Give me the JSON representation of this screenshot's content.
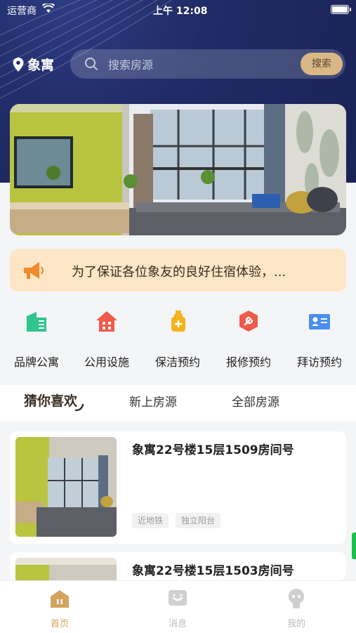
{
  "status": {
    "carrier": "运营商",
    "time": "上午 12:08"
  },
  "location": "象寓",
  "search": {
    "placeholder": "搜索房源",
    "button": "搜索"
  },
  "notice": "为了保证各位象友的良好住宿体验，...",
  "categories": [
    {
      "label": "品牌公寓",
      "icon": "building-icon",
      "color": "#2fc58d"
    },
    {
      "label": "公用设施",
      "icon": "house-icon",
      "color": "#ef5a4a"
    },
    {
      "label": "保洁预约",
      "icon": "spray-bottle-icon",
      "color": "#f6b21e"
    },
    {
      "label": "报修预约",
      "icon": "wrench-icon",
      "color": "#ef5a4a"
    },
    {
      "label": "拜访预约",
      "icon": "id-card-icon",
      "color": "#4a8ef0"
    }
  ],
  "tabs": [
    "猜你喜欢",
    "新上房源",
    "全部房源"
  ],
  "listings": [
    {
      "title": "象寓22号楼15层1509房间号",
      "tags": [
        "近地铁",
        "独立阳台"
      ]
    },
    {
      "title": "象寓22号楼15层1503房间号",
      "tags": []
    }
  ],
  "nav": [
    {
      "label": "首页",
      "icon": "home-icon",
      "active": true
    },
    {
      "label": "消息",
      "icon": "message-icon",
      "active": false
    },
    {
      "label": "我的",
      "icon": "profile-icon",
      "active": false
    }
  ],
  "colors": {
    "accent": "#d9b886",
    "header": "#202b66",
    "notice_bg": "#fde6c6",
    "active_nav": "#d3a45e"
  }
}
